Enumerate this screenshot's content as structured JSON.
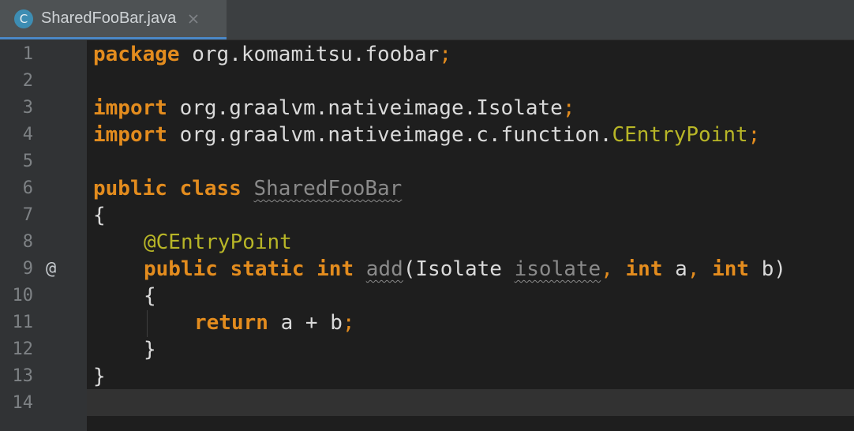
{
  "tab": {
    "icon_letter": "C",
    "title": "SharedFooBar.java",
    "icon_color": "#3d8db3",
    "active_underline": "#4a88c7"
  },
  "gutter": {
    "line_numbers": [
      "1",
      "2",
      "3",
      "4",
      "5",
      "6",
      "7",
      "8",
      "9",
      "10",
      "11",
      "12",
      "13",
      "14"
    ],
    "line9_marker": "@"
  },
  "code": {
    "l1_kw": "package",
    "l1_rest": " org.komamitsu.foobar",
    "l1_semi": ";",
    "l3_kw": "import",
    "l3_rest": " org.graalvm.nativeimage.Isolate",
    "l3_semi": ";",
    "l4_kw": "import",
    "l4_rest": " org.graalvm.nativeimage.c.function.",
    "l4_cls": "CEntryPoint",
    "l4_semi": ";",
    "l6_kw": "public class",
    "l6_sp": " ",
    "l6_cls": "SharedFooBar",
    "l7": "{",
    "l8_ann": "@CEntryPoint",
    "l9_kw1": "public static int",
    "l9_sp": " ",
    "l9_method": "add",
    "l9_p1": "(Isolate ",
    "l9_param": "isolate",
    "l9_c1": ",",
    "l9_sp2": " ",
    "l9_kw2": "int",
    "l9_a": " a",
    "l9_c2": ",",
    "l9_sp3": " ",
    "l9_kw3": "int",
    "l9_b": " b)",
    "l10": "{",
    "l11_kw": "return",
    "l11_rest": " a + b",
    "l11_semi": ";",
    "l12": "}",
    "l13": "}"
  },
  "colors": {
    "keyword": "#e38c1e",
    "annotation": "#b8b627",
    "editor_bg": "#1e1e1e",
    "gutter_bg": "#313335"
  }
}
